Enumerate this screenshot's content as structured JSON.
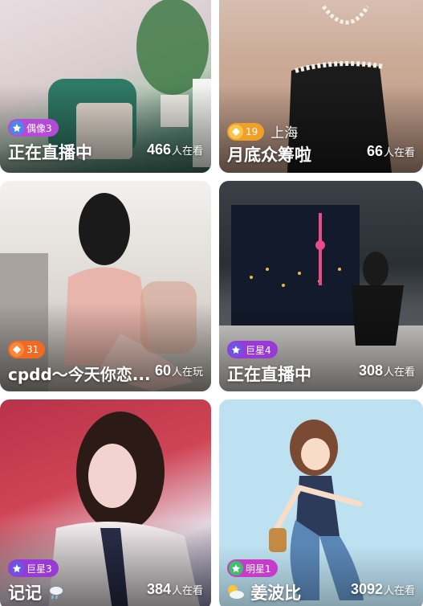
{
  "cards": [
    {
      "badge": {
        "type": "idol",
        "label": "偶像3",
        "color": "#b34bd8"
      },
      "location": "",
      "title": "正在直播中",
      "viewers": "466",
      "viewers_suffix": "人在看"
    },
    {
      "badge": {
        "type": "level",
        "label": "19",
        "color": "#f1a027"
      },
      "location": "上海",
      "title": "月底众筹啦",
      "viewers": "66",
      "viewers_suffix": "人在看"
    },
    {
      "badge": {
        "type": "level",
        "label": "31",
        "color": "#f26a21"
      },
      "location": "",
      "title": "cpdd～今天你恋...",
      "viewers": "60",
      "viewers_suffix": "人在玩"
    },
    {
      "badge": {
        "type": "superstar",
        "label": "巨星4",
        "color": "#9a3ad6"
      },
      "location": "",
      "title": "正在直播中",
      "viewers": "308",
      "viewers_suffix": "人在看"
    },
    {
      "badge": {
        "type": "superstar",
        "label": "巨星3",
        "color": "#9a3ad6"
      },
      "location": "",
      "title": "记记",
      "title_icon": "cloud-rain-icon",
      "viewers": "384",
      "viewers_suffix": "人在看"
    },
    {
      "badge": {
        "type": "star",
        "label": "明星1",
        "color": "#c43cc9"
      },
      "location": "",
      "title": "姜波比",
      "title_icon": "sun-cloud-icon",
      "viewers": "3092",
      "viewers_suffix": "人在看"
    }
  ]
}
